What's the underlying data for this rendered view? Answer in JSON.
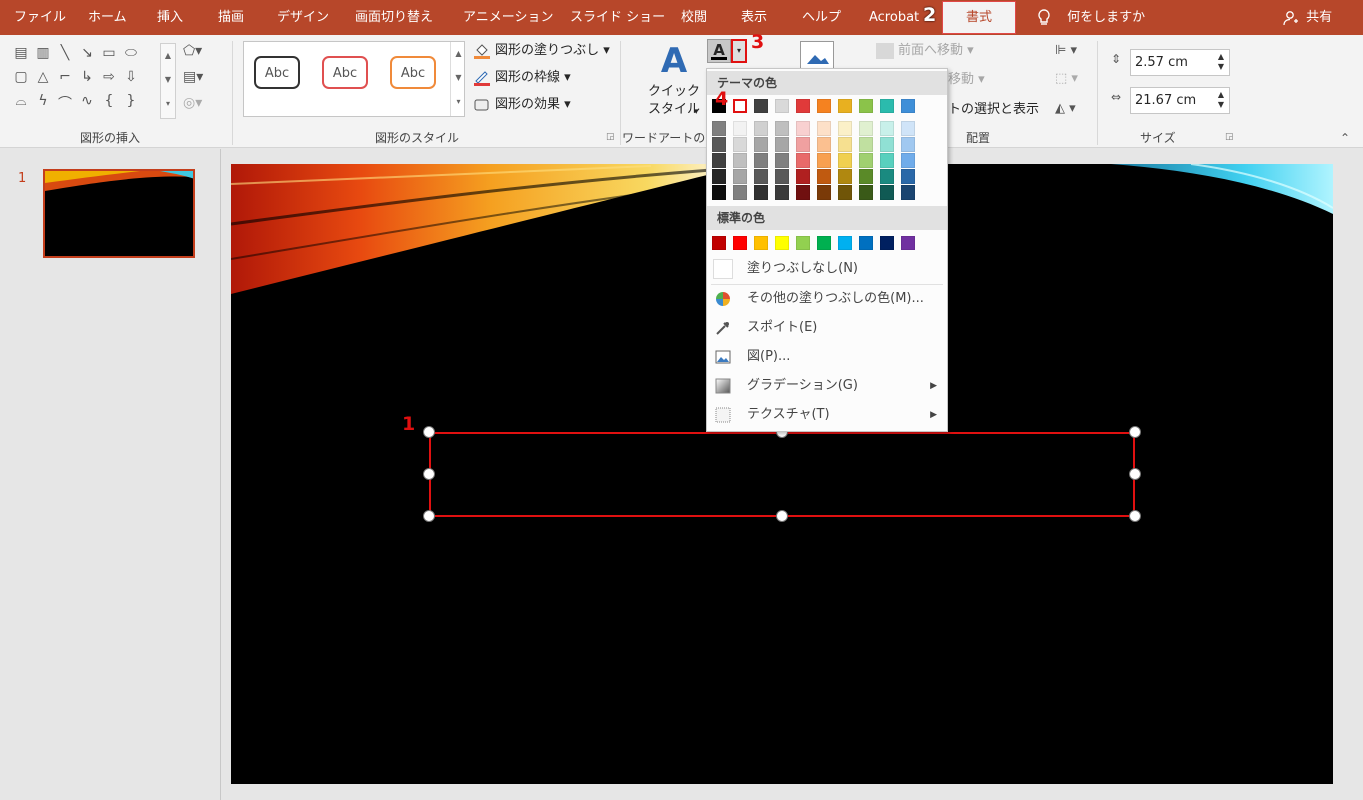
{
  "tabs": {
    "file": "ファイル",
    "home": "ホーム",
    "insert": "挿入",
    "draw": "描画",
    "design": "デザイン",
    "transitions": "画面切り替え",
    "animations": "アニメーション",
    "slideshow": "スライド ショー",
    "review": "校閲",
    "view": "表示",
    "help": "ヘルプ",
    "acrobat": "Acrobat",
    "format": "書式",
    "tell_me": "何をしますか",
    "share": "共有"
  },
  "ribbon": {
    "insert_shapes_label": "図形の挿入",
    "shape_styles_label": "図形のスタイル",
    "wordart_label": "ワードアートの",
    "arrange_label": "配置",
    "size_label": "サイズ",
    "style_preview_text": "Abc",
    "shape_fill": "図形の塗りつぶし",
    "shape_outline": "図形の枠線",
    "shape_effects": "図形の効果",
    "quick_style_line1": "クイック",
    "quick_style_line2": "スタイル",
    "bring_forward": "前面へ移動",
    "send_backward": "移動",
    "selection_pane": "トの選択と表示",
    "height_value": "2.57 cm",
    "width_value": "21.67 cm",
    "text_fill_letter": "A"
  },
  "slides_pane": {
    "slide_number": "1"
  },
  "dropdown": {
    "theme_colors_header": "テーマの色",
    "standard_colors_header": "標準の色",
    "no_fill": "塗りつぶしなし(N)",
    "more_colors": "その他の塗りつぶしの色(M)...",
    "eyedropper": "スポイト(E)",
    "picture": "図(P)...",
    "gradient": "グラデーション(G)",
    "texture": "テクスチャ(T)",
    "theme_top_row": [
      "#000000",
      "#ffffff",
      "#404040",
      "#d9d9d9",
      "#e03a3a",
      "#f58220",
      "#e8b020",
      "#8bc34a",
      "#2bbbad",
      "#3f8fd8"
    ],
    "theme_shades": [
      [
        "#808080",
        "#595959",
        "#404040",
        "#262626",
        "#0d0d0d"
      ],
      [
        "#f2f2f2",
        "#d9d9d9",
        "#bfbfbf",
        "#a6a6a6",
        "#808080"
      ],
      [
        "#d0d0d0",
        "#a6a6a6",
        "#7f7f7f",
        "#595959",
        "#303030"
      ],
      [
        "#bfbfbf",
        "#a6a6a6",
        "#808080",
        "#595959",
        "#3a3a3a"
      ],
      [
        "#f8d0d0",
        "#f0a0a0",
        "#e86a6a",
        "#b02020",
        "#701010"
      ],
      [
        "#fde0c8",
        "#fbc090",
        "#f8a050",
        "#c05a10",
        "#7a3a08"
      ],
      [
        "#fbf0c8",
        "#f6e090",
        "#f0d050",
        "#b08810",
        "#705508"
      ],
      [
        "#e0f0d0",
        "#c0e0a0",
        "#a0d070",
        "#5a8a28",
        "#3a5a18"
      ],
      [
        "#c8f0ea",
        "#90e0d4",
        "#58d0be",
        "#1a8a80",
        "#105a54"
      ],
      [
        "#d0e4f8",
        "#a0c8f0",
        "#70acea",
        "#2a68a8",
        "#1a4470"
      ]
    ],
    "standard": [
      "#c00000",
      "#ff0000",
      "#ffc000",
      "#ffff00",
      "#92d050",
      "#00b050",
      "#00b0f0",
      "#0070c0",
      "#002060",
      "#7030a0"
    ]
  },
  "annotations": {
    "step1": "1",
    "step2": "2",
    "step3": "3",
    "step4": "4"
  }
}
